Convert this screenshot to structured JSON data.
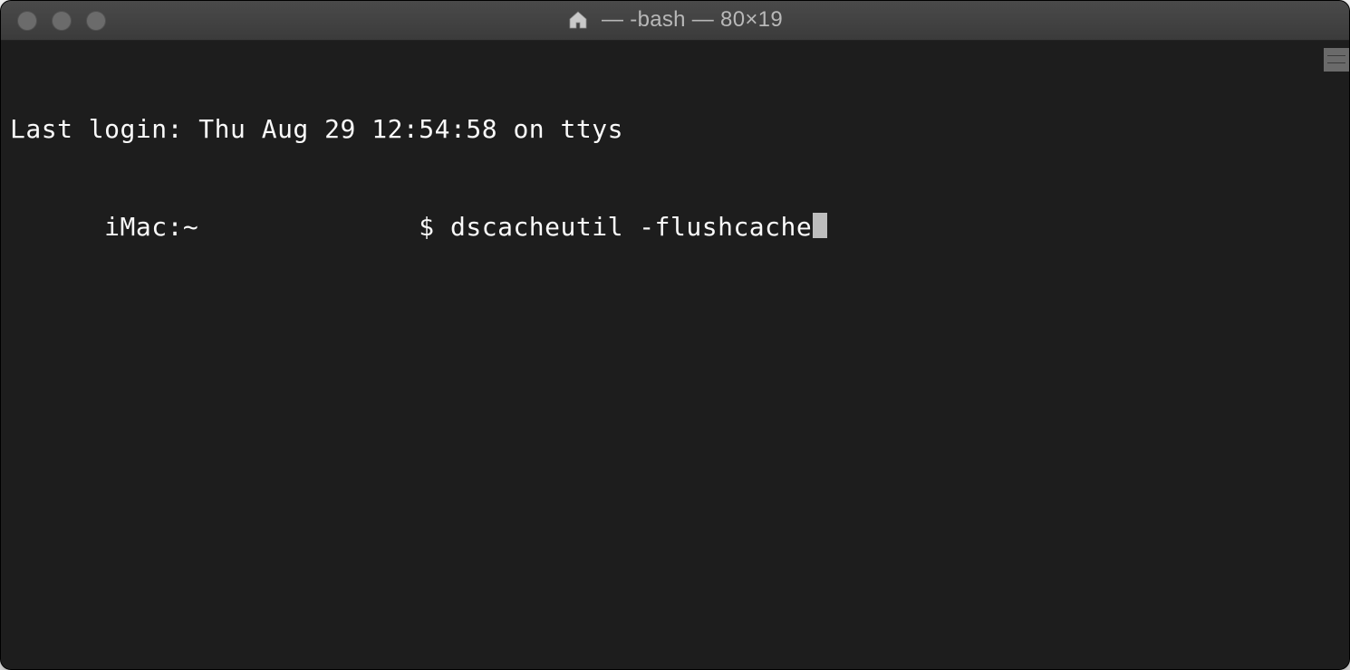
{
  "window": {
    "title": "— -bash — 80×19"
  },
  "terminal": {
    "last_login": "Last login: Thu Aug 29 12:54:58 on ttys",
    "prompt_host": "      iMac:~              ",
    "prompt_symbol": "$ ",
    "command": "dscacheutil -flushcache"
  }
}
